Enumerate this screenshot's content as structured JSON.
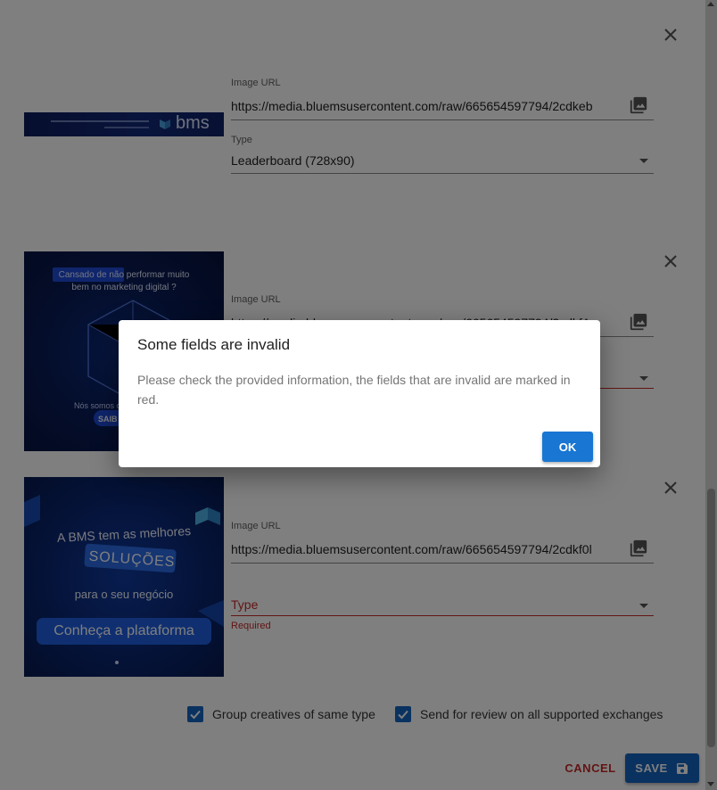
{
  "creatives": [
    {
      "image_url_label": "Image URL",
      "image_url_value": "https://media.bluemsusercontent.com/raw/665654597794/2cdkeb",
      "type_label": "Type",
      "type_value": "Leaderboard (728x90)",
      "banner_text": "bms"
    },
    {
      "image_url_label": "Image URL",
      "image_url_value": "https://media.bluemsusercontent.com/raw/665654597794/2cdkfA",
      "banner_text_line1": "Cansado de não performar muito",
      "banner_text_line2": "bem no marketing digital ?",
      "banner_text_bottom": "Nós somos o",
      "banner_button": "SAIB"
    },
    {
      "image_url_label": "Image URL",
      "image_url_value": "https://media.bluemsusercontent.com/raw/665654597794/2cdkf0l",
      "type_label": "Type",
      "type_helper": "Required",
      "banner_line1": "A BMS tem as melhores",
      "banner_line2": "SOLUÇÕES",
      "banner_line3": "para o seu negócio",
      "banner_button": "Conheça a plataforma"
    }
  ],
  "options": {
    "group_label": "Group creatives of same type",
    "review_label": "Send for review on all supported exchanges"
  },
  "actions": {
    "cancel_label": "CANCEL",
    "save_label": "SAVE"
  },
  "dialog": {
    "title": "Some fields are invalid",
    "body": "Please check the provided information, the fields that are invalid are marked in red.",
    "ok_label": "OK"
  },
  "colors": {
    "primary": "#1565c0",
    "error": "#c62828",
    "banner_dark": "#0b1a4a"
  }
}
